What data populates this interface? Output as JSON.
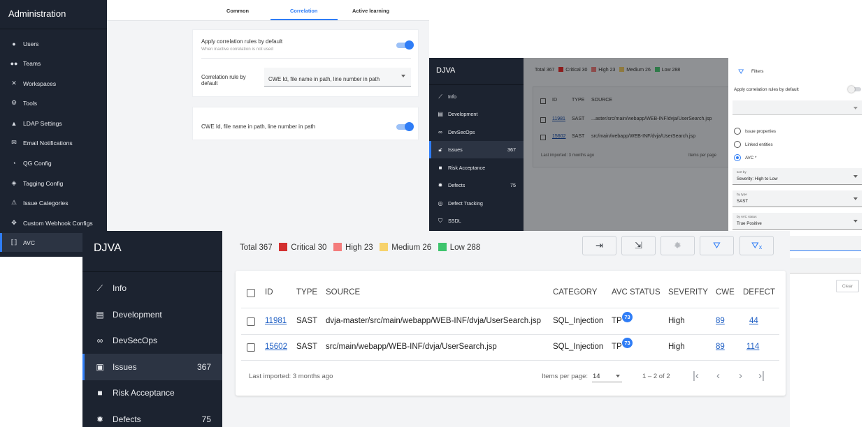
{
  "admin": {
    "title": "Administration",
    "menu": [
      {
        "label": "Users",
        "icon": "person-icon"
      },
      {
        "label": "Teams",
        "icon": "group-icon"
      },
      {
        "label": "Workspaces",
        "icon": "tools-icon"
      },
      {
        "label": "Tools",
        "icon": "tool-icon"
      },
      {
        "label": "LDAP Settings",
        "icon": "ldap-icon"
      },
      {
        "label": "Email Notifications",
        "icon": "mail-icon"
      },
      {
        "label": "QG Config",
        "icon": "gauge-icon"
      },
      {
        "label": "Tagging Config",
        "icon": "tag-icon"
      },
      {
        "label": "Issue Categories",
        "icon": "warning-icon"
      },
      {
        "label": "Custom Webhook Configs",
        "icon": "webhook-icon"
      },
      {
        "label": "AVC",
        "icon": "avc-icon"
      }
    ],
    "tabs": [
      "Common",
      "Correlation",
      "Active learning"
    ],
    "card1": {
      "title": "Apply correlation rules by default",
      "subtitle": "When inactive correlation is not used",
      "rule_label": "Correlation rule by default",
      "rule_value": "CWE Id, file name in path, line number in path"
    },
    "card2": {
      "label": "CWE Id, file name in path, line number in path"
    }
  },
  "mid": {
    "app_title": "DJVA",
    "menu": [
      {
        "label": "Info",
        "icon": "chart-icon",
        "count": ""
      },
      {
        "label": "Development",
        "icon": "book-icon",
        "count": ""
      },
      {
        "label": "DevSecOps",
        "icon": "infinity-icon",
        "count": ""
      },
      {
        "label": "Issues",
        "icon": "lock-icon",
        "count": "367"
      },
      {
        "label": "Risk Acceptance",
        "icon": "lock-closed-icon",
        "count": ""
      },
      {
        "label": "Defects",
        "icon": "bug-icon",
        "count": "75"
      },
      {
        "label": "Defect Tracking",
        "icon": "tracking-icon",
        "count": ""
      },
      {
        "label": "SSDL",
        "icon": "shield-icon",
        "count": ""
      }
    ],
    "summary": {
      "total": "Total 367",
      "critical": "Critical 30",
      "high": "High 23",
      "medium": "Medium 26",
      "low": "Low 288"
    },
    "headers": {
      "id": "ID",
      "type": "TYPE",
      "source": "SOURCE"
    },
    "rows": [
      {
        "id": "11981",
        "type": "SAST",
        "source": "...aster/src/main/webapp/WEB-INF/dvja/UserSearch.jsp"
      },
      {
        "id": "15602",
        "type": "SAST",
        "source": "src/main/webapp/WEB-INF/dvja/UserSearch.jsp"
      }
    ],
    "footer": {
      "imported": "Last imported: 3 months ago",
      "per_page": "Items per page"
    },
    "filters": {
      "title": "Filters",
      "apply_label": "Apply correlation rules by default",
      "radio1": "Issue properties",
      "radio2": "Linked entities",
      "radio3": "AVC *",
      "sort_label": "sort by",
      "sort_value": "Severity: High to Low",
      "type_label": "by type",
      "type_value": "SAST",
      "avc_label": "by AVC status",
      "avc_value": "True Positive",
      "clear": "Clear"
    }
  },
  "front": {
    "app_title": "DJVA",
    "menu": [
      {
        "label": "Info",
        "icon": "chart-icon",
        "count": ""
      },
      {
        "label": "Development",
        "icon": "book-icon",
        "count": ""
      },
      {
        "label": "DevSecOps",
        "icon": "infinity-icon",
        "count": ""
      },
      {
        "label": "Issues",
        "icon": "lock-icon",
        "count": "367"
      },
      {
        "label": "Risk Acceptance",
        "icon": "lock-closed-icon",
        "count": ""
      },
      {
        "label": "Defects",
        "icon": "bug-icon",
        "count": "75"
      }
    ],
    "summary": {
      "total": "Total 367",
      "critical": "Critical 30",
      "high": "High 23",
      "medium": "Medium 26",
      "low": "Low 288"
    },
    "colors": {
      "critical": "#d32f2f",
      "high": "#f47c7c",
      "medium": "#f7d26b",
      "low": "#3ec46d",
      "accent": "#2f7df6",
      "sidebar": "#1c2330"
    },
    "headers": {
      "id": "ID",
      "type": "TYPE",
      "source": "SOURCE",
      "category": "CATEGORY",
      "avc": "AVC STATUS",
      "severity": "SEVERITY",
      "cwe": "CWE",
      "defect": "DEFECT"
    },
    "rows": [
      {
        "id": "11981",
        "type": "SAST",
        "source": "dvja-master/src/main/webapp/WEB-INF/dvja/UserSearch.jsp",
        "category": "SQL_Injection",
        "avc": "TP",
        "avc_badge": "73",
        "severity": "High",
        "cwe": "89",
        "defect": "44"
      },
      {
        "id": "15602",
        "type": "SAST",
        "source": "src/main/webapp/WEB-INF/dvja/UserSearch.jsp",
        "category": "SQL_Injection",
        "avc": "TP",
        "avc_badge": "73",
        "severity": "High",
        "cwe": "89",
        "defect": "114"
      }
    ],
    "footer": {
      "imported": "Last imported: 3 months ago",
      "per_page": "Items per page:",
      "per_page_value": "14",
      "range": "1 – 2 of 2"
    }
  }
}
